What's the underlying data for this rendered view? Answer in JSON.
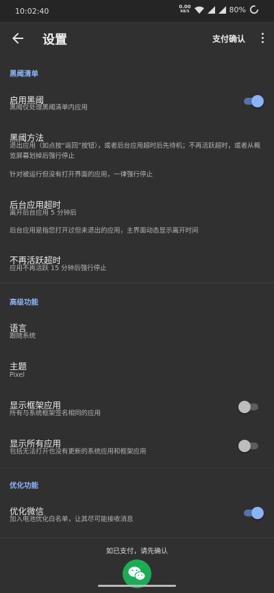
{
  "status_bar": {
    "time": "10:02:40",
    "speed_value": "0.00",
    "speed_unit": "KB/S",
    "battery": "80%"
  },
  "appbar": {
    "title": "设置",
    "action": "支付确认"
  },
  "sections": [
    {
      "header": "黑阈清单"
    },
    {
      "header": "高级功能"
    },
    {
      "header": "优化功能"
    }
  ],
  "rows": {
    "enable": {
      "title": "启用黑阈",
      "subtitle": "黑阈仅处理黑阈清单内应用",
      "toggle": true
    },
    "method": {
      "title": "黑阈方法",
      "subtitle": "退出应用（如点按“返回”按钮），或者后台应用超时后先待机；不再活跃超时，或者从概览屏幕划掉后强行停止",
      "note": "针对被运行但没有打开界面的应用，一律强行停止"
    },
    "timeout": {
      "title": "后台应用超时",
      "subtitle": "离开后台应用 5 分钟后",
      "note": "后台应用是指您打开过但未退出的应用，主界面动态显示离开时间"
    },
    "inactive": {
      "title": "不再活跃超时",
      "subtitle": "应用不再活跃 15 分钟后强行停止"
    },
    "language": {
      "title": "语言",
      "subtitle": "跟随系统"
    },
    "theme": {
      "title": "主题",
      "subtitle": "Pixel"
    },
    "show_framework": {
      "title": "显示框架应用",
      "subtitle": "所有与系统框架签名相同的应用",
      "toggle": false
    },
    "show_all": {
      "title": "显示所有应用",
      "subtitle": "包括无法打开也没有更新的系统应用和框架应用",
      "toggle": false
    },
    "wechat": {
      "title": "优化微信",
      "subtitle": "加入电池优化白名单，让其尽可能接收消息",
      "toggle": true
    }
  },
  "bottom": {
    "text": "如已支付，请先确认"
  },
  "colors": {
    "accent": "#8ab4f8",
    "background": "#303030",
    "wechat_green": "#1aad55"
  }
}
